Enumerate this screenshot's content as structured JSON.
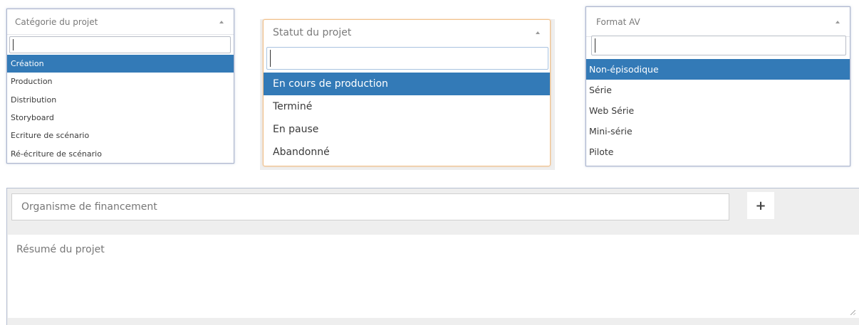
{
  "categorie": {
    "label": "Catégorie du projet",
    "search_value": "",
    "options": [
      "Création",
      "Production",
      "Distribution",
      "Storyboard",
      "Ecriture de scénario",
      "Ré-écriture de scénario"
    ],
    "selected": "Création"
  },
  "statut": {
    "label": "Statut du projet",
    "search_value": "",
    "options": [
      "En cours de production",
      "Terminé",
      "En pause",
      "Abandonné"
    ],
    "selected": "En cours de production"
  },
  "format": {
    "label": "Format AV",
    "search_value": "",
    "options": [
      "Non-épisodique",
      "Série",
      "Web Série",
      "Mini-série",
      "Pilote"
    ],
    "selected": "Non-épisodique"
  },
  "funding": {
    "placeholder": "Organisme de financement",
    "add_label": "+"
  },
  "summary": {
    "placeholder": "Résumé du projet"
  },
  "colors": {
    "highlight": "#337ab7",
    "border": "#aab4cc",
    "panel_bg": "#eeeeee"
  }
}
